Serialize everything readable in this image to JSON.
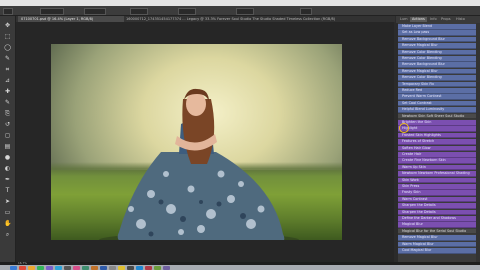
{
  "document": {
    "tab_active": "07100701.psd @ 16.4% (Layer 1, RGB/8)",
    "tab_second": "160000712_174351454177374 ... Legacy @ 33.3% Forever Soul Studio The Studio Shaded Timeless Collection (RGB/8)",
    "status_zoom": "16.7%"
  },
  "panel": {
    "tabs": [
      "Lum",
      "Actions",
      "Info",
      "Props",
      "Histo"
    ]
  },
  "actions": [
    {
      "label": "Make Layer Blend",
      "color": "blue"
    },
    {
      "label": "Set as Low pass",
      "color": "blue"
    },
    {
      "label": "Remove Background Blur",
      "color": "blue"
    },
    {
      "label": "Remove Magical Blur",
      "color": "blue"
    },
    {
      "label": "Remove Color Blending",
      "color": "blue"
    },
    {
      "label": "Remove Color Blending",
      "color": "blue"
    },
    {
      "label": "Remove Background Blur",
      "color": "blue"
    },
    {
      "label": "Remove Magical Blur",
      "color": "blue"
    },
    {
      "label": "Remove Color Blending",
      "color": "blue"
    },
    {
      "label": "Temporary Skin Fix",
      "color": "blue"
    },
    {
      "label": "Reduce Red",
      "color": "blue"
    },
    {
      "label": "Prevent Warm Contrast",
      "color": "blue"
    },
    {
      "label": "Set Cool Contrast",
      "color": "blue"
    },
    {
      "label": "Helpful Blend Luminosity",
      "color": "blue"
    },
    {
      "label": "Newborn Skin Soft Sheer Soul Studio",
      "color": "gray"
    },
    {
      "label": "Brighten the Skin",
      "color": "purple"
    },
    {
      "label": "Highlight",
      "color": "purple"
    },
    {
      "label": "Frosted Skin Highlights",
      "color": "purple"
    },
    {
      "label": "Features of Stretch",
      "color": "purple"
    },
    {
      "label": "Soften Hair Glow",
      "color": "purple"
    },
    {
      "label": "Create Hair",
      "color": "purple"
    },
    {
      "label": "Create Fine Newborn Skin",
      "color": "purple"
    },
    {
      "label": "Warm Up Skin",
      "color": "purple"
    },
    {
      "label": "Newborn Newborn Professional Shading",
      "color": "purple"
    },
    {
      "label": "Skin Work",
      "color": "purple"
    },
    {
      "label": "Skin Press",
      "color": "purple"
    },
    {
      "label": "Frosty Skin",
      "color": "purple"
    },
    {
      "label": "Warm Contrast",
      "color": "purple"
    },
    {
      "label": "Sharpen the Details",
      "color": "purple"
    },
    {
      "label": "Sharpen the Details",
      "color": "purple"
    },
    {
      "label": "Define the Darker and Shadows",
      "color": "purple"
    },
    {
      "label": "Magical Blur",
      "color": "purple"
    },
    {
      "label": "Magical Blur for the Serial Soul Studio",
      "color": "gray"
    },
    {
      "label": "Remove Magical Blur",
      "color": "blue"
    },
    {
      "label": "Warm Magical Blur",
      "color": "blue"
    },
    {
      "label": "Cool Magical Blur",
      "color": "blue"
    }
  ],
  "colors": {
    "blue_action": "#5b6ea5",
    "purple_action": "#7b4fb0",
    "cursor_highlight": "#f2c318"
  },
  "tools": [
    "move-tool",
    "marquee-tool",
    "lasso-tool",
    "quick-select-tool",
    "crop-tool",
    "eyedropper-tool",
    "healing-tool",
    "brush-tool",
    "clone-tool",
    "history-brush-tool",
    "eraser-tool",
    "gradient-tool",
    "blur-tool",
    "dodge-tool",
    "pen-tool",
    "type-tool",
    "path-select-tool",
    "shape-tool",
    "hand-tool",
    "zoom-tool"
  ]
}
